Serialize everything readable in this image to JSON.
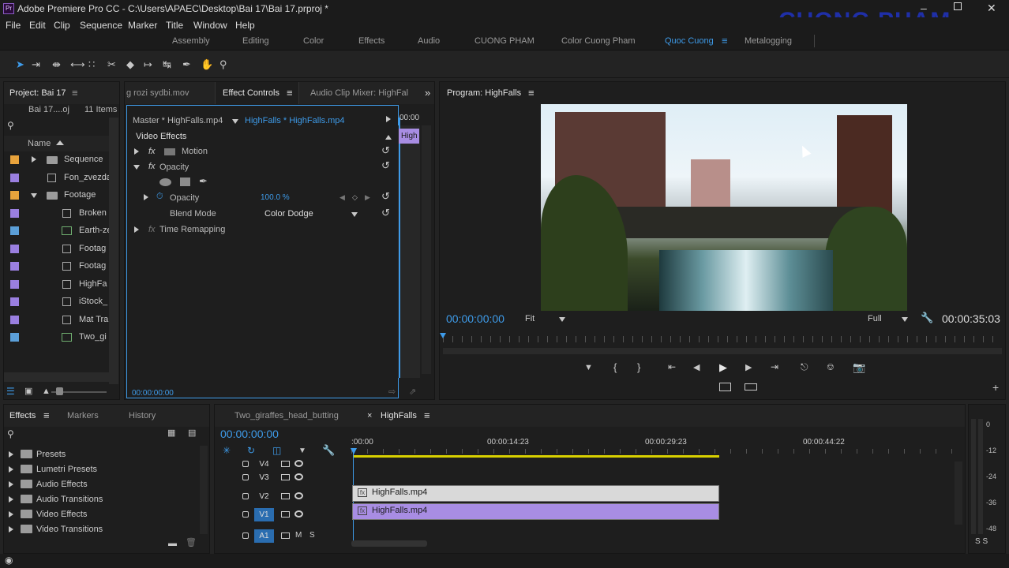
{
  "app": {
    "title": "Adobe Premiere Pro CC - C:\\Users\\APAEC\\Desktop\\Bai 17\\Bai 17.prproj *",
    "watermark": "CUONG PHAM"
  },
  "menu": [
    "File",
    "Edit",
    "Clip",
    "Sequence",
    "Marker",
    "Title",
    "Window",
    "Help"
  ],
  "workspaces": [
    "Assembly",
    "Editing",
    "Color",
    "Effects",
    "Audio",
    "CUONG PHAM",
    "Color Cuong Pham",
    "Quoc Cuong",
    "Metalogging"
  ],
  "project": {
    "title": "Project: Bai 17",
    "file": "Bai 17....oj",
    "count": "11 Items",
    "column": "Name",
    "items": [
      {
        "label": "Sequence",
        "color": "#e8a33c",
        "kind": "folder",
        "expand": "right",
        "indent": 0
      },
      {
        "label": "Fon_zvezda",
        "color": "#9a7fe0",
        "kind": "seq",
        "expand": "",
        "indent": 0
      },
      {
        "label": "Footage",
        "color": "#e8a33c",
        "kind": "folder",
        "expand": "down",
        "indent": 0
      },
      {
        "label": "Broken",
        "color": "#9a7fe0",
        "kind": "seq",
        "expand": "",
        "indent": 1
      },
      {
        "label": "Earth-ze",
        "color": "#5b9fd8",
        "kind": "clip",
        "expand": "",
        "indent": 1
      },
      {
        "label": "Footag",
        "color": "#9a7fe0",
        "kind": "seq",
        "expand": "",
        "indent": 1
      },
      {
        "label": "Footag",
        "color": "#9a7fe0",
        "kind": "seq",
        "expand": "",
        "indent": 1
      },
      {
        "label": "HighFa",
        "color": "#9a7fe0",
        "kind": "seq",
        "expand": "",
        "indent": 1
      },
      {
        "label": "iStock_",
        "color": "#9a7fe0",
        "kind": "seq",
        "expand": "",
        "indent": 1
      },
      {
        "label": "Mat Tra",
        "color": "#9a7fe0",
        "kind": "seq",
        "expand": "",
        "indent": 1
      },
      {
        "label": "Two_gi",
        "color": "#5b9fd8",
        "kind": "clip",
        "expand": "",
        "indent": 1
      }
    ]
  },
  "effect_controls": {
    "tabs": [
      "g rozi sydbi.mov",
      "Effect Controls",
      "Audio Clip Mixer: HighFal"
    ],
    "master": "Master * HighFalls.mp4",
    "clip": "HighFalls * HighFalls.mp4",
    "mini_time": "00:00",
    "mini_clip": "High",
    "section": "Video Effects",
    "motion": "Motion",
    "opacity_group": "Opacity",
    "opacity_label": "Opacity",
    "opacity_value": "100.0 %",
    "blend_label": "Blend Mode",
    "blend_value": "Color Dodge",
    "time_remap": "Time Remapping",
    "timecode": "00:00:00:00"
  },
  "program": {
    "title": "Program: HighFalls",
    "timecode": "00:00:00:00",
    "fit": "Fit",
    "quality": "Full",
    "duration": "00:00:35:03"
  },
  "effects_panel": {
    "tabs": [
      "Effects",
      "Markers",
      "History"
    ],
    "items": [
      "Presets",
      "Lumetri Presets",
      "Audio Effects",
      "Audio Transitions",
      "Video Effects",
      "Video Transitions"
    ]
  },
  "timeline": {
    "tabs": [
      "Two_giraffes_head_butting",
      "HighFalls"
    ],
    "timecode": "00:00:00:00",
    "ruler": [
      ":00:00",
      "00:00:14:23",
      "00:00:29:23",
      "00:00:44:22"
    ],
    "tracks": [
      "V4",
      "V3",
      "V2",
      "V1",
      "A1"
    ],
    "track_m": "M",
    "track_s": "S",
    "clips": [
      {
        "label": "HighFalls.mp4",
        "track": "V2",
        "color": "#d9d9d9"
      },
      {
        "label": "HighFalls.mp4",
        "track": "V1",
        "color": "#a88de3"
      }
    ]
  },
  "meter": {
    "labels": [
      "0",
      "-12",
      "-24",
      "-36",
      "-48"
    ],
    "solo": "S S"
  }
}
